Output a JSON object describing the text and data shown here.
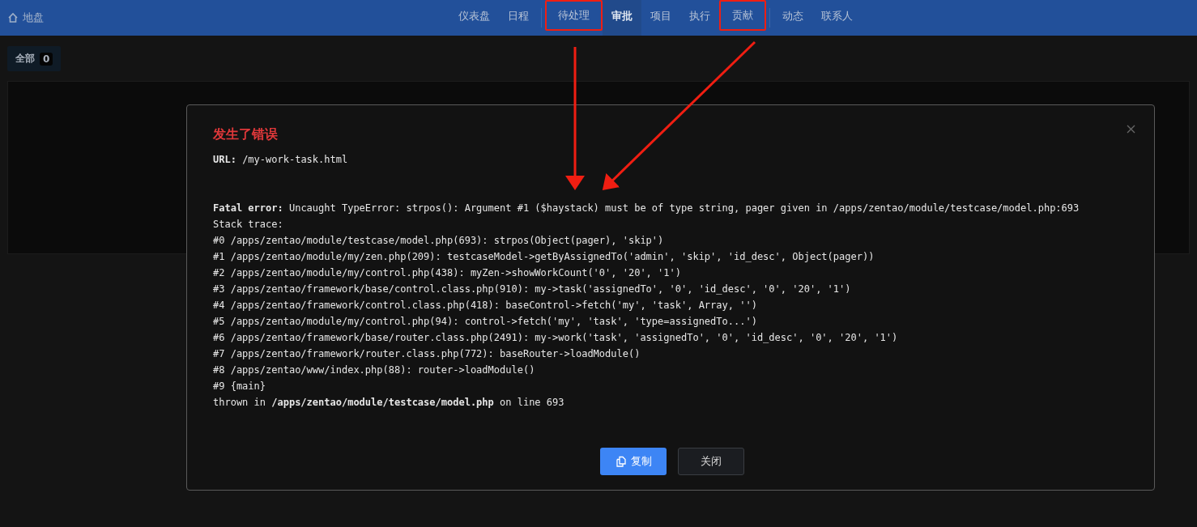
{
  "header": {
    "brand": "地盘",
    "nav_groups": [
      [
        {
          "label": "仪表盘",
          "selected": false,
          "annotated": false
        },
        {
          "label": "日程",
          "selected": false,
          "annotated": false
        }
      ],
      [
        {
          "label": "待处理",
          "selected": false,
          "annotated": true
        },
        {
          "label": "审批",
          "selected": true,
          "annotated": false
        },
        {
          "label": "项目",
          "selected": false,
          "annotated": false
        },
        {
          "label": "执行",
          "selected": false,
          "annotated": false
        },
        {
          "label": "贡献",
          "selected": false,
          "annotated": true
        }
      ],
      [
        {
          "label": "动态",
          "selected": false,
          "annotated": false
        },
        {
          "label": "联系人",
          "selected": false,
          "annotated": false
        }
      ]
    ]
  },
  "tabs": [
    {
      "label": "全部",
      "count": "0",
      "selected": true
    }
  ],
  "dialog": {
    "title": "发生了错误",
    "url_line": "**URL:** /my-work-task.html",
    "lines": [
      "**Fatal error:** Uncaught TypeError: strpos(): Argument #1 ($haystack) must be of type string, pager given in /apps/zentao/module/testcase/model.php:693",
      "Stack trace:",
      "#0 /apps/zentao/module/testcase/model.php(693): strpos(Object(pager), 'skip')",
      "#1 /apps/zentao/module/my/zen.php(209): testcaseModel->getByAssignedTo('admin', 'skip', 'id_desc', Object(pager))",
      "#2 /apps/zentao/module/my/control.php(438): myZen->showWorkCount('0', '20', '1')",
      "#3 /apps/zentao/framework/base/control.class.php(910): my->task('assignedTo', '0', 'id_desc', '0', '20', '1')",
      "#4 /apps/zentao/framework/control.class.php(418): baseControl->fetch('my', 'task', Array, '')",
      "#5 /apps/zentao/module/my/control.php(94): control->fetch('my', 'task', 'type=assignedTo...')",
      "#6 /apps/zentao/framework/base/router.class.php(2491): my->work('task', 'assignedTo', '0', 'id_desc', '0', '20', '1')",
      "#7 /apps/zentao/framework/router.class.php(772): baseRouter->loadModule()",
      "#8 /apps/zentao/www/index.php(88): router->loadModule()",
      "#9 {main}",
      "thrown in **/apps/zentao/module/testcase/model.php** on line 693"
    ],
    "buttons": [
      {
        "label": "复制",
        "kind": "primary"
      },
      {
        "label": "关闭",
        "kind": "secondary"
      }
    ]
  }
}
